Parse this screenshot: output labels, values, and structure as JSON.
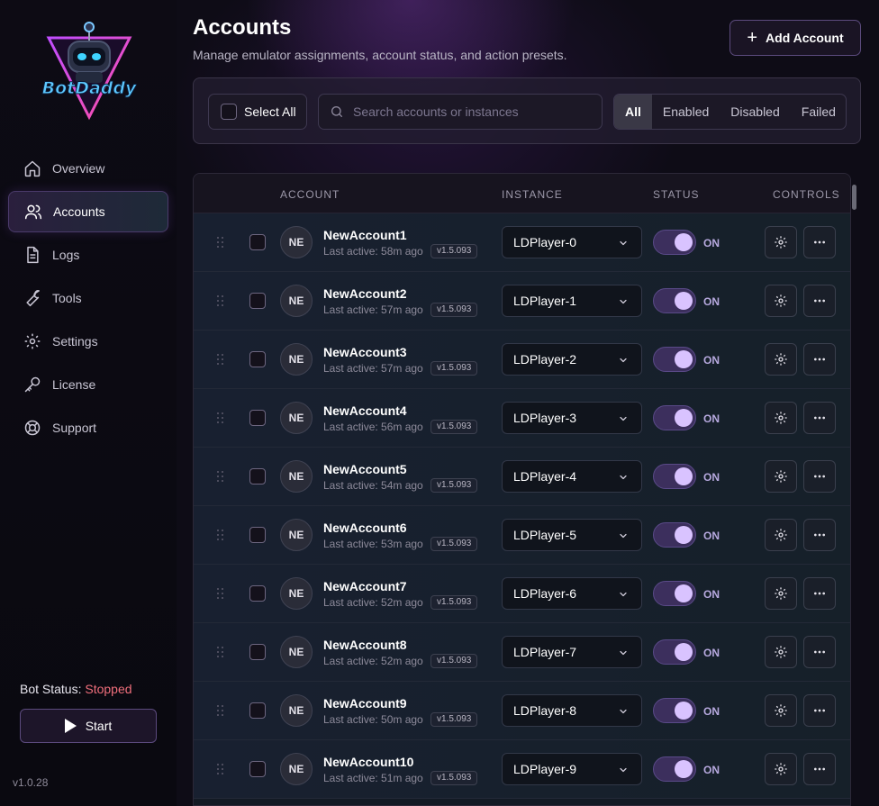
{
  "sidebar": {
    "logo_text": "BotDaddy",
    "nav": [
      {
        "label": "Overview",
        "icon": "home-icon"
      },
      {
        "label": "Accounts",
        "icon": "users-icon",
        "active": true
      },
      {
        "label": "Logs",
        "icon": "document-icon"
      },
      {
        "label": "Tools",
        "icon": "wrench-icon"
      },
      {
        "label": "Settings",
        "icon": "gear-icon"
      },
      {
        "label": "License",
        "icon": "key-icon"
      },
      {
        "label": "Support",
        "icon": "lifebuoy-icon"
      }
    ],
    "bot_status_label": "Bot Status:",
    "bot_status_value": "Stopped",
    "start_label": "Start",
    "version": "v1.0.28"
  },
  "header": {
    "title": "Accounts",
    "subtitle": "Manage emulator assignments, account status, and action presets.",
    "add_label": "Add Account"
  },
  "filters": {
    "select_all_label": "Select All",
    "search_placeholder": "Search accounts or instances",
    "segments": [
      "All",
      "Enabled",
      "Disabled",
      "Failed"
    ],
    "active_segment": "All"
  },
  "table": {
    "columns": {
      "account": "ACCOUNT",
      "instance": "INSTANCE",
      "status": "STATUS",
      "controls": "CONTROLS"
    },
    "rows": [
      {
        "initials": "NE",
        "name": "NewAccount1",
        "last_active": "Last active: 58m ago",
        "version": "v1.5.093",
        "instance": "LDPlayer-0",
        "status": "ON"
      },
      {
        "initials": "NE",
        "name": "NewAccount2",
        "last_active": "Last active: 57m ago",
        "version": "v1.5.093",
        "instance": "LDPlayer-1",
        "status": "ON"
      },
      {
        "initials": "NE",
        "name": "NewAccount3",
        "last_active": "Last active: 57m ago",
        "version": "v1.5.093",
        "instance": "LDPlayer-2",
        "status": "ON"
      },
      {
        "initials": "NE",
        "name": "NewAccount4",
        "last_active": "Last active: 56m ago",
        "version": "v1.5.093",
        "instance": "LDPlayer-3",
        "status": "ON"
      },
      {
        "initials": "NE",
        "name": "NewAccount5",
        "last_active": "Last active: 54m ago",
        "version": "v1.5.093",
        "instance": "LDPlayer-4",
        "status": "ON"
      },
      {
        "initials": "NE",
        "name": "NewAccount6",
        "last_active": "Last active: 53m ago",
        "version": "v1.5.093",
        "instance": "LDPlayer-5",
        "status": "ON"
      },
      {
        "initials": "NE",
        "name": "NewAccount7",
        "last_active": "Last active: 52m ago",
        "version": "v1.5.093",
        "instance": "LDPlayer-6",
        "status": "ON"
      },
      {
        "initials": "NE",
        "name": "NewAccount8",
        "last_active": "Last active: 52m ago",
        "version": "v1.5.093",
        "instance": "LDPlayer-7",
        "status": "ON"
      },
      {
        "initials": "NE",
        "name": "NewAccount9",
        "last_active": "Last active: 50m ago",
        "version": "v1.5.093",
        "instance": "LDPlayer-8",
        "status": "ON"
      },
      {
        "initials": "NE",
        "name": "NewAccount10",
        "last_active": "Last active: 51m ago",
        "version": "v1.5.093",
        "instance": "LDPlayer-9",
        "status": "ON"
      }
    ]
  },
  "colors": {
    "accent": "#d9c3ff",
    "stopped": "#f06f7c",
    "background": "#0e0c16"
  }
}
